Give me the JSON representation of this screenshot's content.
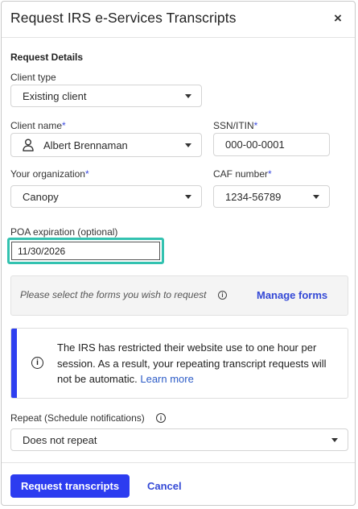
{
  "dialog": {
    "title": "Request IRS e-Services Transcripts",
    "close_icon": "×"
  },
  "section_title": "Request Details",
  "client_type": {
    "label": "Client type",
    "value": "Existing client"
  },
  "client_name": {
    "label": "Client name",
    "required": "*",
    "value": "Albert Brennaman",
    "icon": "person-icon"
  },
  "ssn": {
    "label": "SSN/ITIN",
    "required": "*",
    "value": "000-00-0001"
  },
  "organization": {
    "label": "Your organization",
    "required": "*",
    "value": "Canopy"
  },
  "caf": {
    "label": "CAF number",
    "required": "*",
    "value": "1234-56789"
  },
  "poa": {
    "label": "POA expiration (optional)",
    "value": "11/30/2026"
  },
  "forms": {
    "prompt": "Please select the forms you wish to request",
    "info_glyph": "i",
    "manage_label": "Manage forms"
  },
  "alert": {
    "icon_glyph": "i",
    "message": "The IRS has restricted their website use to one hour per session. As a result, your repeating transcript requests will not be automatic.",
    "link": "Learn more"
  },
  "repeat": {
    "label": "Repeat (Schedule notifications)",
    "info_glyph": "i",
    "value": "Does not repeat"
  },
  "footer": {
    "primary_label": "Request transcripts",
    "cancel_label": "Cancel"
  },
  "colors": {
    "accent": "#2c3cf0",
    "focus_ring": "#33c2b0",
    "link": "#3449d6"
  }
}
